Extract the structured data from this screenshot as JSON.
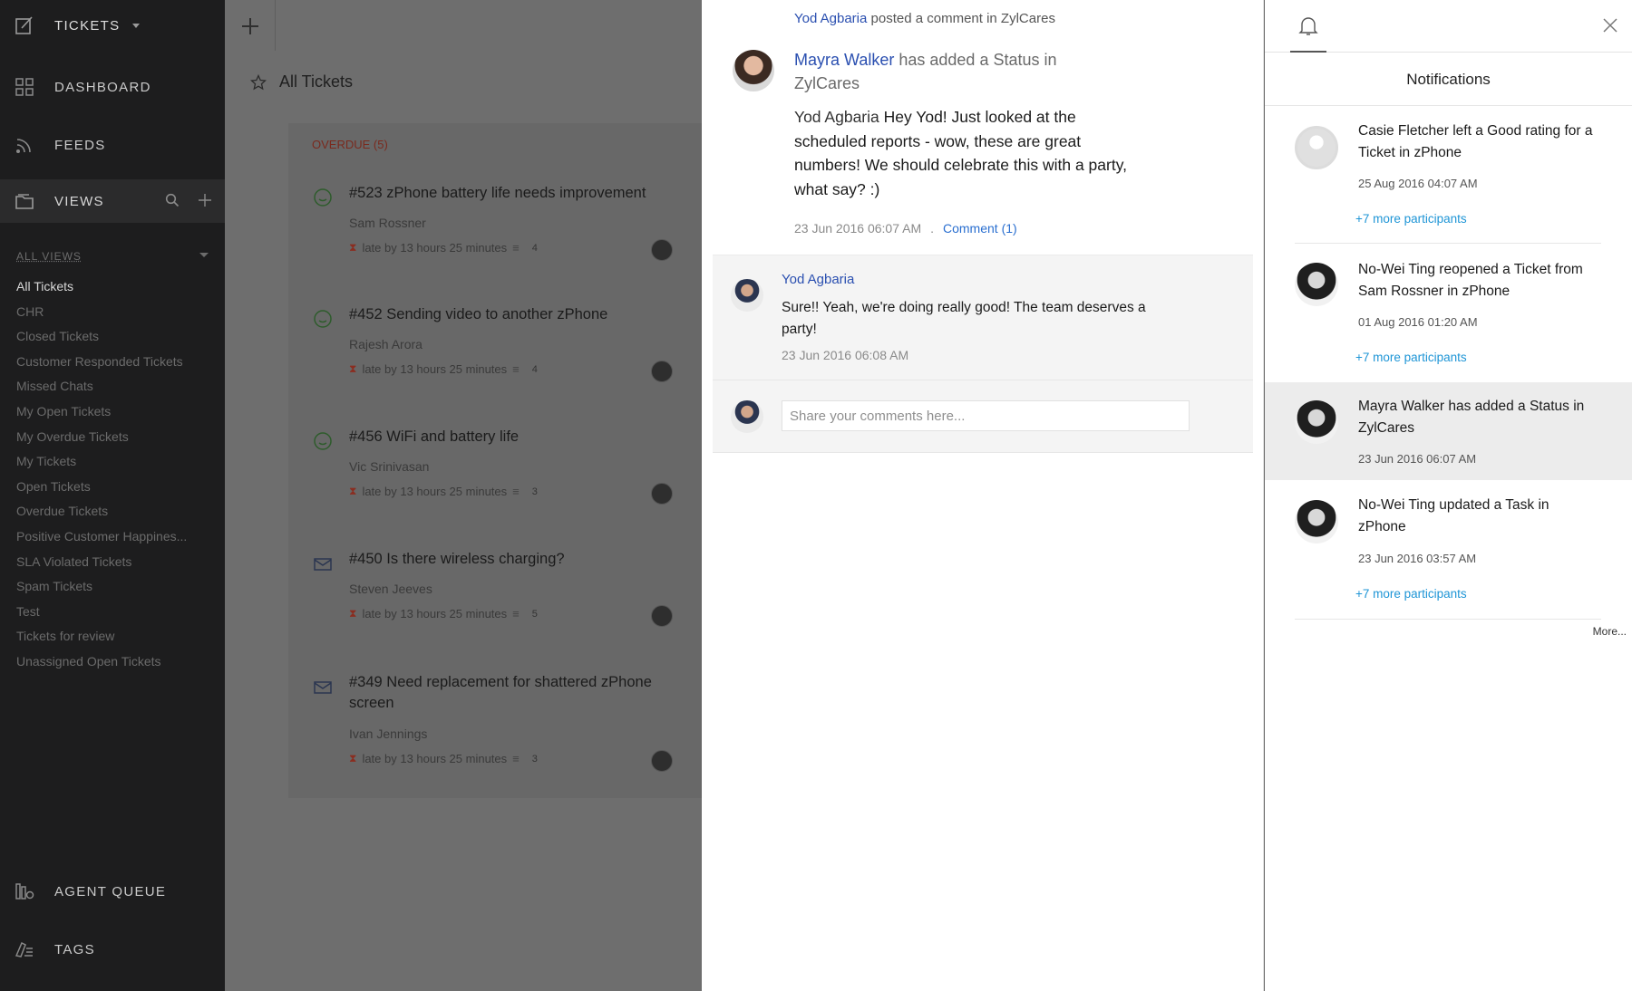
{
  "sidebar": {
    "module": "TICKETS",
    "nav": {
      "dashboard": "DASHBOARD",
      "feeds": "FEEDS",
      "views": "VIEWS",
      "agent_queue": "AGENT QUEUE",
      "tags": "TAGS"
    },
    "all_views_header": "ALL VIEWS",
    "views": [
      "All Tickets",
      "CHR",
      "Closed Tickets",
      "Customer Responded Tickets",
      "Missed Chats",
      "My Open Tickets",
      "My Overdue Tickets",
      "My Tickets",
      "Open Tickets",
      "Overdue Tickets",
      "Positive Customer Happines...",
      "SLA Violated Tickets",
      "Spam Tickets",
      "Test",
      "Tickets for review",
      "Unassigned Open Tickets"
    ]
  },
  "list": {
    "title": "All Tickets",
    "group_label": "OVERDUE (5)",
    "tickets": [
      {
        "title": "#523 zPhone battery life needs improvement",
        "contact": "Sam Rossner",
        "late": "late by 13 hours 25 minutes",
        "threads": "4",
        "channel": "happiness-icon"
      },
      {
        "title": "#452 Sending video to another zPhone",
        "contact": "Rajesh Arora",
        "late": "late by 13 hours 25 minutes",
        "threads": "4",
        "channel": "happiness-icon"
      },
      {
        "title": "#456 WiFi and battery life",
        "contact": "Vic Srinivasan",
        "late": "late by 13 hours 25 minutes",
        "threads": "3",
        "channel": "happiness-icon"
      },
      {
        "title": "#450 Is there wireless charging?",
        "contact": "Steven Jeeves",
        "late": "late by 13 hours 25 minutes",
        "threads": "5",
        "channel": "email-icon"
      },
      {
        "title": "#349 Need replacement for shattered zPhone screen",
        "contact": "Ivan Jennings",
        "late": "late by 13 hours 25 minutes",
        "threads": "3",
        "channel": "email-icon"
      }
    ]
  },
  "conversation": {
    "top_line": {
      "who": "Yod Agbaria",
      "rest": " posted a comment in ZylCares"
    },
    "post": {
      "who": "Mayra Walker",
      "action": " has added a Status in ZylCares",
      "mention": "Yod Agbaria",
      "body": " Hey Yod! Just looked at the scheduled reports - wow, these are great numbers! We should celebrate this with a party, what say? :)",
      "time": "23 Jun 2016 06:07 AM",
      "separator": ".",
      "comment_link": "Comment (1)"
    },
    "reply": {
      "who": "Yod Agbaria",
      "text": "Sure!! Yeah, we're doing really good! The team deserves a party!",
      "time": "23 Jun 2016 06:08 AM"
    },
    "comment_placeholder": "Share your comments here..."
  },
  "notifications": {
    "title": "Notifications",
    "items": [
      {
        "text": "Casie Fletcher left a Good rating for a Ticket in zPhone",
        "time": "25 Aug 2016 04:07 AM",
        "more": "+7 more participants"
      },
      {
        "text": "No-Wei Ting reopened a Ticket from Sam Rossner in zPhone",
        "time": "01 Aug 2016 01:20 AM",
        "more": "+7 more participants"
      },
      {
        "text": "Mayra Walker has added a Status in ZylCares",
        "time": "23 Jun 2016 06:07 AM",
        "more": ""
      },
      {
        "text": "No-Wei Ting updated a Task in zPhone",
        "time": "23 Jun 2016 03:57 AM",
        "more": "+7 more participants"
      }
    ],
    "more_link": "More..."
  },
  "colors": {
    "sidebar_bg": "#1d1d1e",
    "link_blue": "#2a4fb0",
    "participants_blue": "#1e95d6",
    "overdue_red": "#7a2a1e"
  }
}
